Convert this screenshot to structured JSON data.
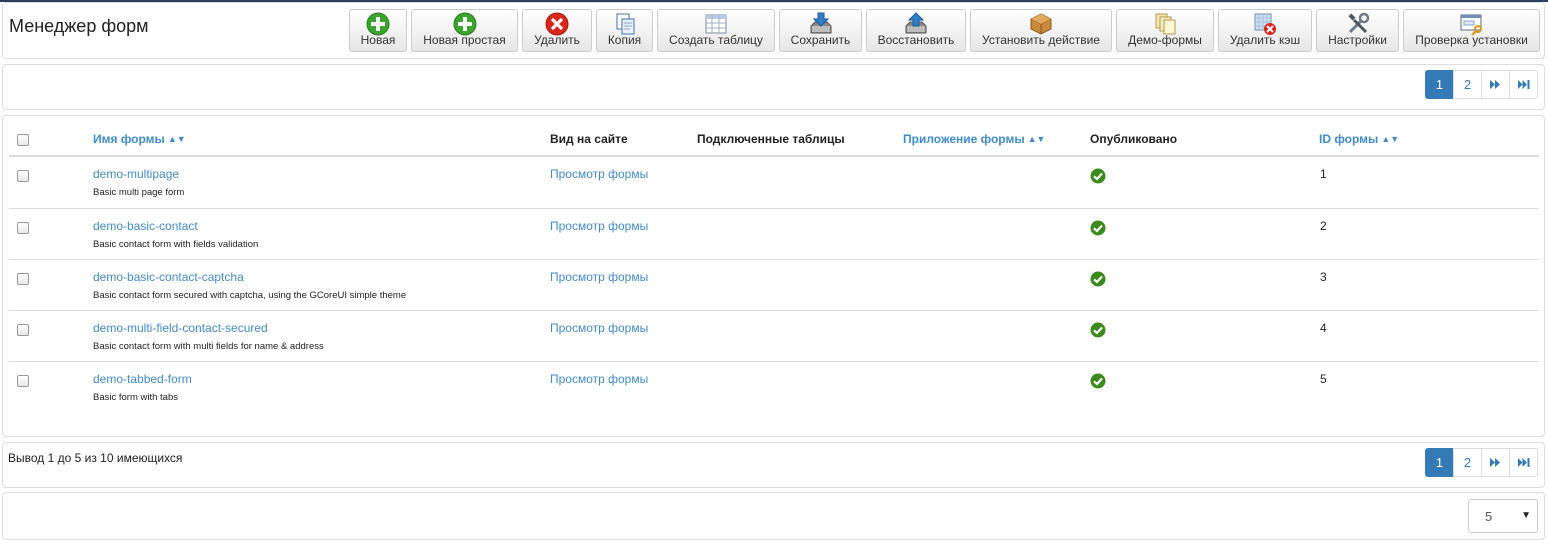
{
  "page_title": "Менеджер форм",
  "toolbar": [
    {
      "label": "Новая",
      "icon": "add-green-icon"
    },
    {
      "label": "Новая простая",
      "icon": "add-green-icon"
    },
    {
      "label": "Удалить",
      "icon": "delete-red-icon"
    },
    {
      "label": "Копия",
      "icon": "copy-icon"
    },
    {
      "label": "Создать таблицу",
      "icon": "table-icon"
    },
    {
      "label": "Сохранить",
      "icon": "download-box-icon"
    },
    {
      "label": "Восстановить",
      "icon": "upload-box-icon"
    },
    {
      "label": "Установить действие",
      "icon": "package-icon"
    },
    {
      "label": "Демо-формы",
      "icon": "documents-icon"
    },
    {
      "label": "Удалить кэш",
      "icon": "clear-cache-icon"
    },
    {
      "label": "Настройки",
      "icon": "tools-icon"
    },
    {
      "label": "Проверка установки",
      "icon": "install-check-icon"
    }
  ],
  "pagination": {
    "pages": [
      "1",
      "2"
    ],
    "current": "1",
    "next": "▶▶",
    "last": "▶▶|"
  },
  "table": {
    "headers": {
      "form_name": "Имя формы",
      "site_view": "Вид на сайте",
      "tables": "Подключенные таблицы",
      "app": "Приложение формы",
      "published": "Опубликовано",
      "form_id": "ID формы"
    },
    "rows": [
      {
        "name": "demo-multipage",
        "desc": "Basic multi page form",
        "view": "Просмотр формы",
        "id": "1"
      },
      {
        "name": "demo-basic-contact",
        "desc": "Basic contact form with fields validation",
        "view": "Просмотр формы",
        "id": "2"
      },
      {
        "name": "demo-basic-contact-captcha",
        "desc": "Basic contact form secured with captcha, using the GCoreUI simple theme",
        "view": "Просмотр формы",
        "id": "3"
      },
      {
        "name": "demo-multi-field-contact-secured",
        "desc": "Basic contact form with multi fields for name & address",
        "view": "Просмотр формы",
        "id": "4"
      },
      {
        "name": "demo-tabbed-form",
        "desc": "Basic form with tabs",
        "view": "Просмотр формы",
        "id": "5"
      }
    ]
  },
  "count_text": "Вывод 1 до 5 из 10 имеющихся",
  "limit": {
    "value": "5"
  },
  "colors": {
    "link": "#428bca",
    "active_page": "#337ab7",
    "published_green": "#3c8a1e"
  }
}
